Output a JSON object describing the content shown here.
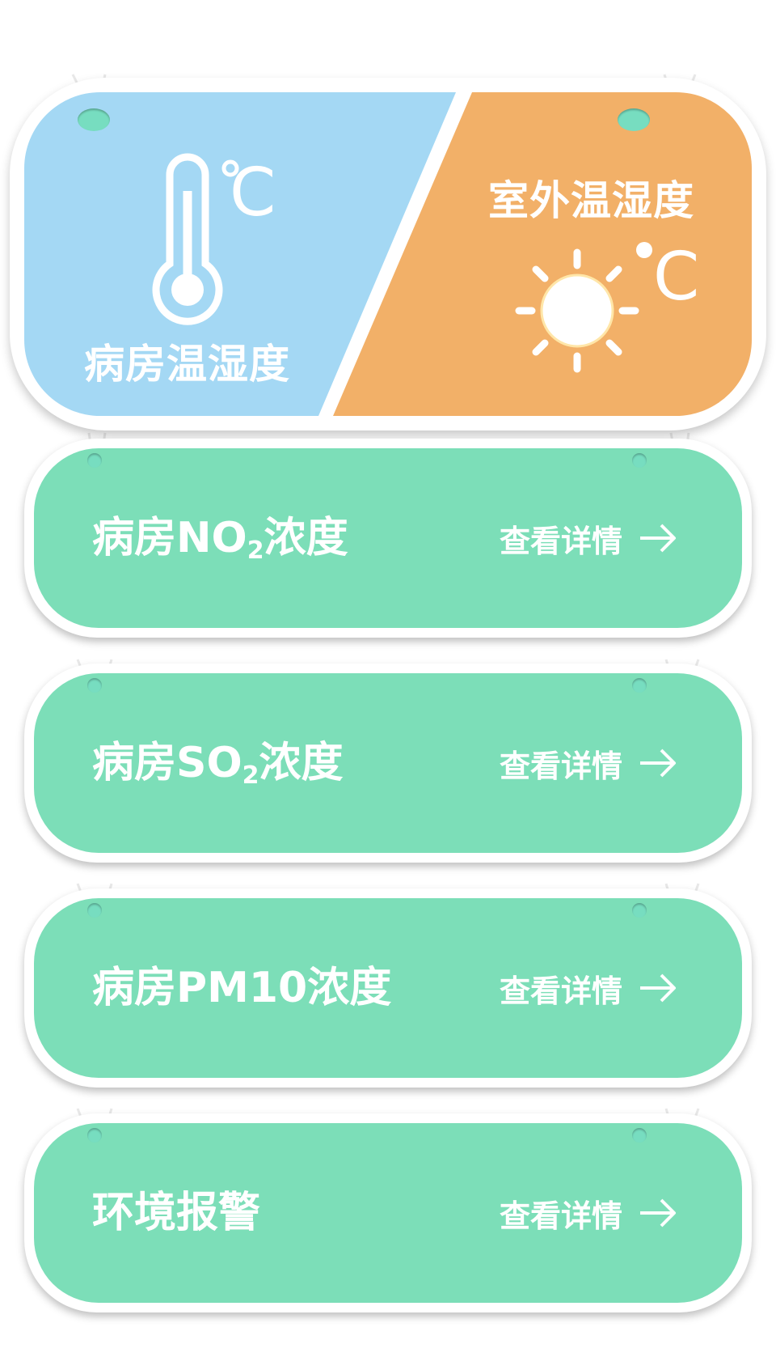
{
  "indoor": {
    "label": "病房温湿度",
    "unit": "°C",
    "icon": "thermometer-icon",
    "color": "#a4d8f4"
  },
  "outdoor": {
    "label": "室外温湿度",
    "unit": "°C",
    "icon": "sun-icon",
    "color": "#f2b068"
  },
  "link_label": "查看详情",
  "cards": [
    {
      "title_prefix": "病房NO",
      "subscript": "2",
      "title_suffix": "浓度",
      "link": "查看详情"
    },
    {
      "title_prefix": "病房SO",
      "subscript": "2",
      "title_suffix": "浓度",
      "link": "查看详情"
    },
    {
      "title_prefix": "病房PM10浓度",
      "subscript": "",
      "title_suffix": "",
      "link": "查看详情"
    },
    {
      "title_prefix": "环境报警",
      "subscript": "",
      "title_suffix": "",
      "link": "查看详情"
    }
  ],
  "colors": {
    "card": "#7cdeb8",
    "indoor": "#a4d8f4",
    "outdoor": "#f2b068"
  }
}
